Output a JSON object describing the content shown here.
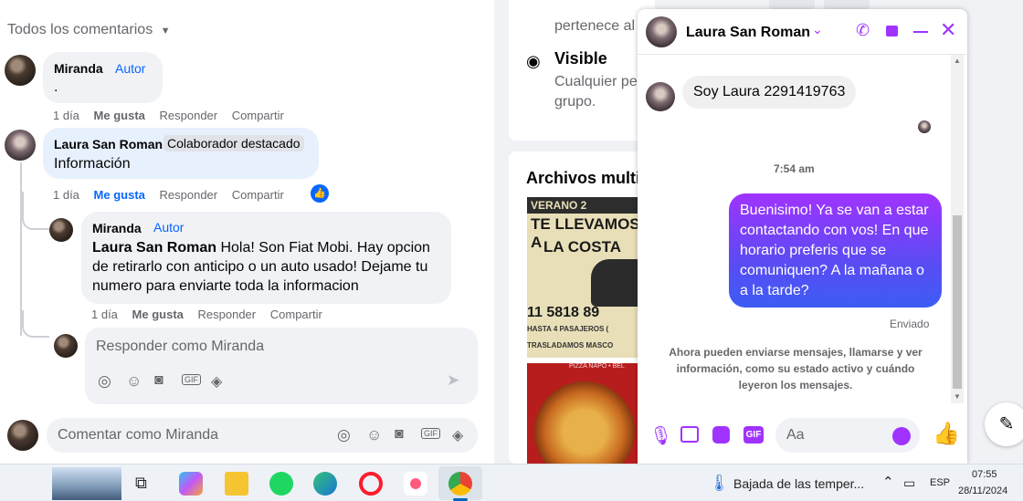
{
  "comments": {
    "header": "Todos los comentarios",
    "c1": {
      "name": "Miranda",
      "badge": "Autor",
      "text": ".",
      "time": "1 día",
      "like": "Me gusta",
      "reply": "Responder",
      "share": "Compartir"
    },
    "c2": {
      "name": "Laura San Roman",
      "badge": "Colaborador destacado",
      "text": "Información",
      "time": "1 día",
      "like": "Me gusta",
      "reply": "Responder",
      "share": "Compartir"
    },
    "c3": {
      "name": "Miranda",
      "badge": "Autor",
      "mention": "Laura San Roman",
      "text": " Hola! Son Fiat Mobi. Hay opcion de retirarlo con anticipo o un auto usado! Dejame tu numero para enviarte toda la informacion",
      "time": "1 día",
      "like": "Me gusta",
      "reply": "Responder",
      "share": "Compartir"
    },
    "reply_placeholder": "Responder como Miranda",
    "comment_placeholder": "Comentar como Miranda"
  },
  "group": {
    "partial_text": "pertenece al",
    "visible_title": "Visible",
    "visible_desc_1": "Cualquier pe",
    "visible_desc_2": "grupo.",
    "files_title": "Archivos multi",
    "ad1_line1": "VERANO 2",
    "ad1_line2": "TE LLEVAMOS A",
    "ad1_line3": "LA COSTA",
    "ad1_phone": "11 5818 89",
    "ad1_small1": "HASTA 4 PASAJEROS (",
    "ad1_small2": "TRASLADAMOS MASCO",
    "ad2_text": "PIZZA NAPO • BEL"
  },
  "chat": {
    "contact": "Laura San Roman",
    "incoming": "Soy Laura 2291419763",
    "time": "7:54 am",
    "outgoing": "Buenisimo! Ya se van a estar contactando con vos! En que horario preferis que se comuniquen? A la mañana o a la tarde?",
    "status": "Enviado",
    "notice": "Ahora pueden enviarse mensajes, llamarse y ver información, como su estado activo y cuándo leyeron los mensajes.",
    "input_placeholder": "Aa",
    "accent": "#a033ff"
  },
  "taskbar": {
    "weather": "Bajada de las temper...",
    "lang": "ESP",
    "clock_time": "07:55",
    "clock_date": "28/11/2024"
  }
}
